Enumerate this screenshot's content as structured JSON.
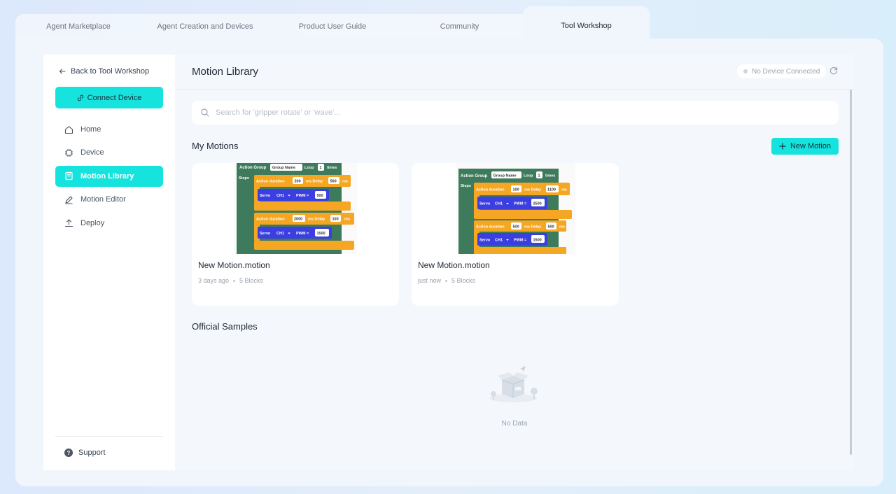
{
  "top_tabs": [
    {
      "label": "Agent Marketplace"
    },
    {
      "label": "Agent Creation and Devices"
    },
    {
      "label": "Product User Guide"
    },
    {
      "label": "Community"
    },
    {
      "label": "Tool Workshop",
      "active": true
    }
  ],
  "sidebar": {
    "back_label": "Back to Tool Workshop",
    "connect_label": "Connect Device",
    "items": [
      {
        "label": "Home",
        "icon": "home-icon"
      },
      {
        "label": "Device",
        "icon": "chip-icon"
      },
      {
        "label": "Motion Library",
        "icon": "library-icon",
        "active": true
      },
      {
        "label": "Motion Editor",
        "icon": "pen-icon"
      },
      {
        "label": "Deploy",
        "icon": "upload-icon"
      }
    ],
    "support_label": "Support"
  },
  "header": {
    "title": "Motion Library",
    "device_status": "No Device Connected"
  },
  "search": {
    "placeholder": "Search for 'gripper rotate' or 'wave'...",
    "value": ""
  },
  "my_motions": {
    "title": "My Motions",
    "new_label": "New Motion",
    "cards": [
      {
        "name": "New Motion.motion",
        "time": "3 days ago",
        "blocks": "5 Blocks",
        "preview": {
          "group_label": "Action Group",
          "group_name": "Group Name",
          "loop_label": "Loop",
          "loop_value": "1",
          "times_label": "times",
          "steps_label": "Steps",
          "actions": [
            {
              "label": "Action duration",
              "duration": "200",
              "delay_label": "ms Delay",
              "delay": "500",
              "unit": "ms",
              "servo": "Servo",
              "channel": "CH1",
              "pwm_label": "PWM =",
              "pwm": "500"
            },
            {
              "label": "Action duration",
              "duration": "2000",
              "delay_label": "ms Delay",
              "delay": "100",
              "unit": "ms",
              "servo": "Servo",
              "channel": "CH1",
              "pwm_label": "PWM =",
              "pwm": "1500"
            }
          ]
        }
      },
      {
        "name": "New Motion.motion",
        "time": "just now",
        "blocks": "5 Blocks",
        "preview": {
          "group_label": "Action Group",
          "group_name": "Group Name",
          "loop_label": "Loop",
          "loop_value": "1",
          "times_label": "times",
          "steps_label": "Steps",
          "actions": [
            {
              "label": "Action duration",
              "duration": "100",
              "delay_label": "ms Delay",
              "delay": "1100",
              "unit": "ms",
              "servo": "Servo",
              "channel": "CH1",
              "pwm_label": "PWM =",
              "pwm": "2500"
            },
            {
              "label": "Action duration",
              "duration": "500",
              "delay_label": "ms Delay",
              "delay": "500",
              "unit": "ms",
              "servo": "Servo",
              "channel": "CH1",
              "pwm_label": "PWM =",
              "pwm": "1500"
            }
          ]
        }
      }
    ]
  },
  "official_samples": {
    "title": "Official Samples",
    "empty_text": "No Data"
  },
  "colors": {
    "accent": "#17e3de",
    "block_green": "#3e7a5c",
    "block_orange": "#f5a623",
    "block_blue": "#3b3ee0"
  }
}
